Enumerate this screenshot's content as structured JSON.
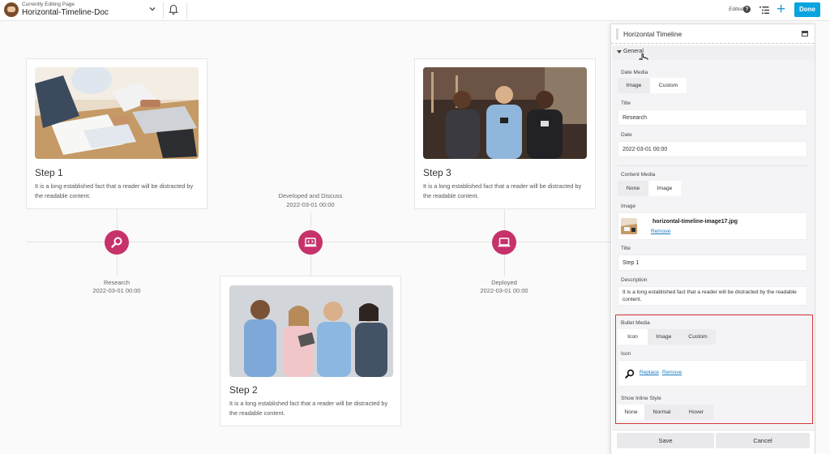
{
  "topbar": {
    "editing_label": "Currently Editing Page",
    "page_name": "Horizontal-Timeline-Doc",
    "edited_label": "Edited",
    "help_label": "?",
    "add_label": "+",
    "done_label": "Done"
  },
  "timeline": {
    "cards": [
      {
        "title": "Step 1",
        "text": "It is a long established fact that a reader will be distracted by the readable content."
      },
      {
        "title": "Step 2",
        "text": "It is a long established fact that a reader will be distracted by the readable content."
      },
      {
        "title": "Step 3",
        "text": "It is a long established fact that a reader will be distracted by the readable content."
      }
    ],
    "items": [
      {
        "label": "Research",
        "date": "2022-03-01 00:00",
        "icon": "search-icon"
      },
      {
        "label": "Developed and Discuss",
        "date": "2022-03-01 00:00",
        "icon": "laptop-code-icon"
      },
      {
        "label": "Deployed",
        "date": "2022-03-01 00:00",
        "icon": "laptop-icon"
      }
    ],
    "colors": {
      "bullet": "#c6326a",
      "line": "#e2e2e2"
    }
  },
  "panel": {
    "title": "Horizontal Timeline",
    "section": "General",
    "date_media": {
      "label": "Date Media",
      "options": [
        "Image",
        "Custom"
      ],
      "selected": "Custom"
    },
    "title_field": {
      "label": "Title",
      "value": "Research"
    },
    "date_field": {
      "label": "Date",
      "value": "2022-03-01 00:00"
    },
    "content_media": {
      "label": "Content Media",
      "options": [
        "None",
        "Image"
      ],
      "selected": "Image"
    },
    "image_field": {
      "label": "Image",
      "filename": "horizontal-timeline-image17.jpg",
      "remove_label": "Remove"
    },
    "title2_field": {
      "label": "Title",
      "value": "Step 1"
    },
    "description_field": {
      "label": "Description",
      "value": "It is a long established fact that a reader will be distracted by the readable content."
    },
    "bullet_media": {
      "label": "Bullet Media",
      "options": [
        "Icon",
        "Image",
        "Custom"
      ],
      "selected": "Icon"
    },
    "icon_field": {
      "label": "Icon",
      "replace_label": "Replace",
      "remove_label": "Remove",
      "icon": "search-icon"
    },
    "inline_style": {
      "label": "Show Inline Style",
      "options": [
        "None",
        "Normal",
        "Hover"
      ],
      "selected": "None"
    },
    "save_label": "Save",
    "cancel_label": "Cancel",
    "highlight_color": "#d9383a"
  }
}
